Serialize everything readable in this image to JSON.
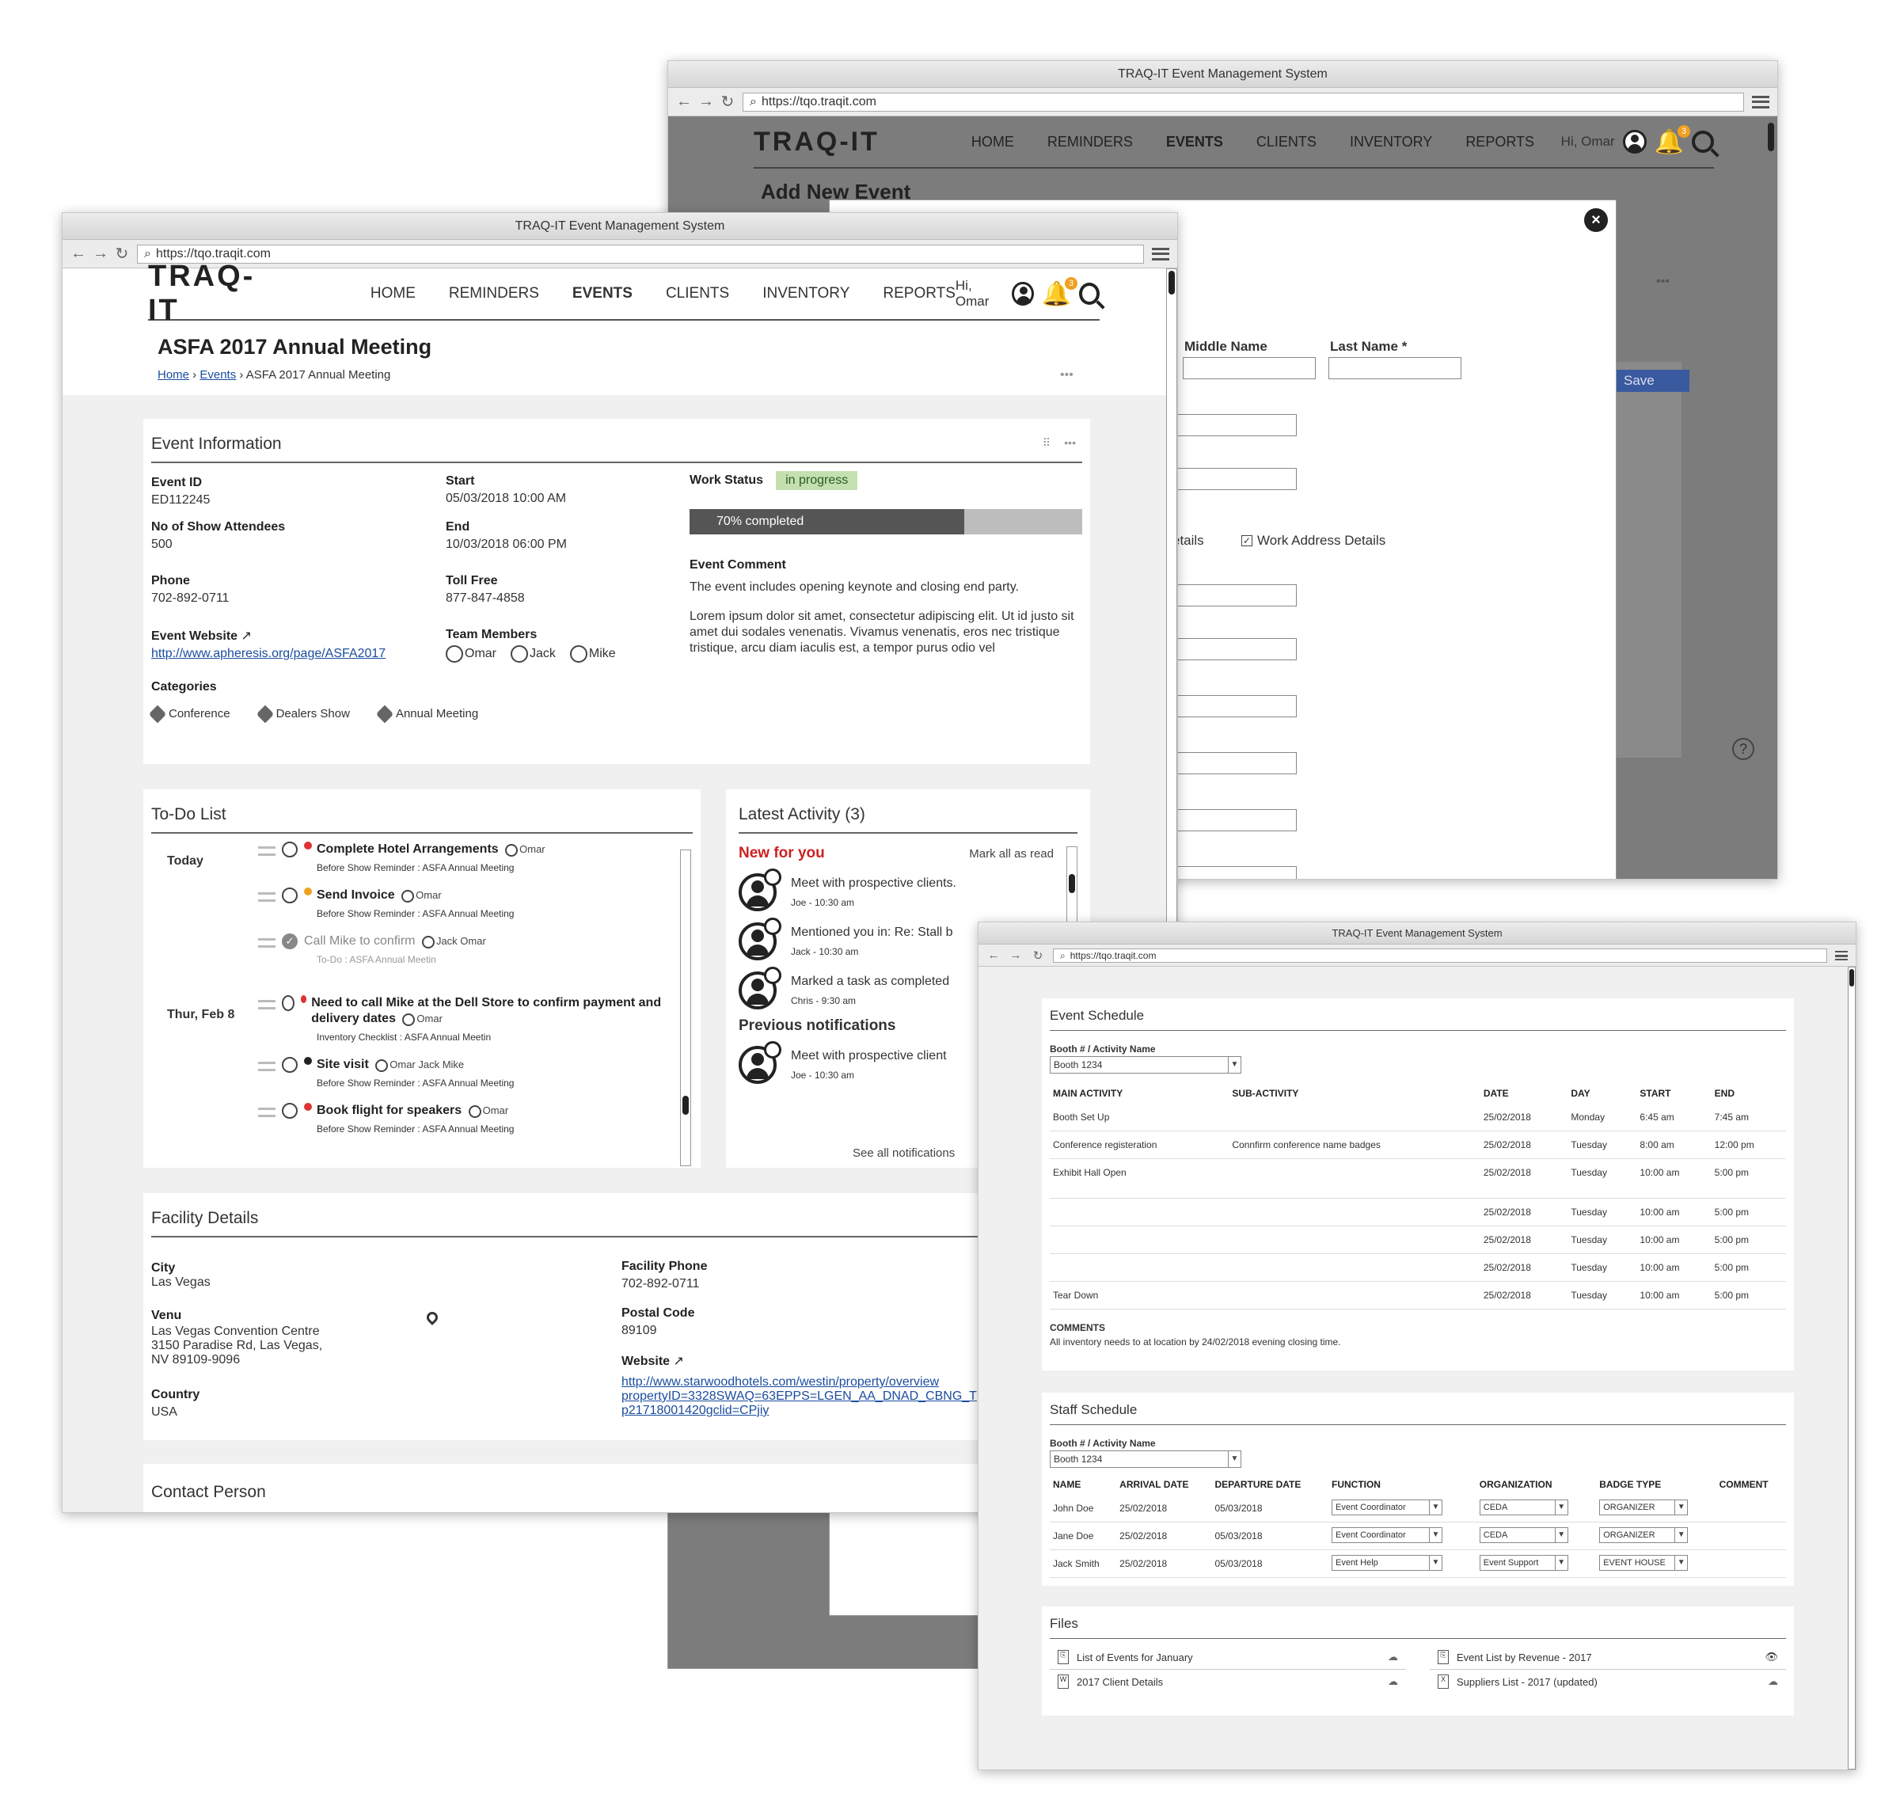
{
  "browser": {
    "title": "TRAQ-IT Event Management System",
    "url": "https://tqo.traqit.com"
  },
  "nav": {
    "logo": "TRAQ-IT",
    "links": [
      "HOME",
      "REMINDERS",
      "EVENTS",
      "CLIENTS",
      "INVENTORY",
      "REPORTS"
    ],
    "active": "EVENTS",
    "greeting": "Hi, Omar",
    "notification_count": "3"
  },
  "back_window": {
    "page_title": "Add New Event",
    "save_label": "Save",
    "middle_name_label": "Middle Name",
    "last_name_label": "Last Name *",
    "home_details_partial": "etails",
    "work_address_label": "Work Address Details"
  },
  "event": {
    "title": "ASFA 2017 Annual Meeting",
    "breadcrumb": {
      "home": "Home",
      "events": "Events",
      "current": "ASFA 2017 Annual Meeting"
    },
    "info_title": "Event Information",
    "event_id_label": "Event ID",
    "event_id": "ED112245",
    "attendees_label": "No of Show Attendees",
    "attendees": "500",
    "phone_label": "Phone",
    "phone": "702-892-0711",
    "website_label": "Event Website",
    "website": "http://www.apheresis.org/page/ASFA2017",
    "start_label": "Start",
    "start": "05/03/2018 10:00 AM",
    "end_label": "End",
    "end": "10/03/2018 06:00 PM",
    "tollfree_label": "Toll Free",
    "tollfree": "877-847-4858",
    "team_label": "Team Members",
    "team": [
      "Omar",
      "Jack",
      "Mike"
    ],
    "work_status_label": "Work Status",
    "work_status": "in progress",
    "progress_text": "70% completed",
    "progress": 0.7,
    "comment_label": "Event Comment",
    "comment1": "The event includes opening keynote and closing end party.",
    "comment2": "Lorem ipsum dolor sit amet, consectetur adipiscing elit. Ut id justo sit amet dui sodales venenatis. Vivamus venenatis, eros nec tristique tristique, arcu diam iaculis est, a tempor purus odio vel",
    "categories_label": "Categories",
    "categories": [
      "Conference",
      "Dealers Show",
      "Annual Meeting"
    ]
  },
  "todo": {
    "title": "To-Do List",
    "groups": [
      {
        "day": "Today",
        "items": [
          {
            "title": "Complete Hotel Arrangements",
            "people": "Omar",
            "sub": "Before Show Reminder : ASFA Annual Meeting",
            "color": "#d33",
            "done": false
          },
          {
            "title": "Send Invoice",
            "people": "Omar",
            "sub": "Before Show Reminder : ASFA Annual Meeting",
            "color": "#f0a020",
            "done": false
          },
          {
            "title": "Call Mike to confirm",
            "people": "Jack   Omar",
            "sub": "To-Do : ASFA Annual Meetin",
            "color": "",
            "done": true
          }
        ]
      },
      {
        "day": "Thur, Feb 8",
        "items": [
          {
            "title": "Need to call Mike at the Dell Store to confirm payment and delivery dates",
            "people": "Omar",
            "sub": "Inventory Checklist  : ASFA Annual Meetin",
            "color": "#d33",
            "done": false
          },
          {
            "title": "Site visit",
            "people": "Omar   Jack   Mike",
            "sub": "Before Show Reminder : ASFA Annual Meeting",
            "color": "#222",
            "done": false
          },
          {
            "title": "Book flight for speakers",
            "people": "Omar",
            "sub": "Before Show Reminder : ASFA Annual Meeting",
            "color": "#d33",
            "done": false
          }
        ]
      }
    ]
  },
  "activity": {
    "title": "Latest Activity (3)",
    "new_label": "New for you",
    "mark_read": "Mark all as read",
    "items": [
      {
        "text": "Meet with prospective clients.",
        "meta": "Joe - 10:30 am"
      },
      {
        "text": "Mentioned you in: Re: Stall b",
        "meta": "Jack - 10:30 am"
      },
      {
        "text": "Marked a task as completed",
        "meta": "Chris - 9:30 am"
      }
    ],
    "prev_label": "Previous notifications",
    "prev_items": [
      {
        "text": "Meet with prospective client",
        "meta": "Joe - 10:30 am"
      }
    ],
    "see_all": "See all notifications"
  },
  "facility": {
    "title": "Facility Details",
    "city_label": "City",
    "city": "Las Vegas",
    "venue_label": "Venu",
    "venue": [
      "Las Vegas Convention Centre",
      "3150 Paradise Rd, Las Vegas,",
      "NV 89109-9096"
    ],
    "country_label": "Country",
    "country": "USA",
    "phone_label": "Facility Phone",
    "phone": "702-892-0711",
    "postal_label": "Postal Code",
    "postal": "89109",
    "website_label": "Website",
    "website": [
      "http://www.starwoodhotels.com/westin/property/overview",
      "propertyID=3328SWAQ=63EPPS=LGEN_AA_DNAD_CBNG_T",
      "p21718001420gclid=CPjiy"
    ],
    "contact_title": "Contact Person"
  },
  "schedule": {
    "title": "Event Schedule",
    "booth_label": "Booth # / Activity Name",
    "booth_value": "Booth 1234",
    "headers": [
      "MAIN ACTIVITY",
      "SUB-ACTIVITY",
      "DATE",
      "DAY",
      "START",
      "END"
    ],
    "rows": [
      [
        "Booth Set Up",
        "",
        "25/02/2018",
        "Monday",
        "6:45 am",
        "7:45 am"
      ],
      [
        "Conference registeration",
        "Connfirm conference name badges",
        "25/02/2018",
        "Tuesday",
        "8:00 am",
        "12:00 pm"
      ],
      [
        "Exhibit Hall Open",
        "",
        "25/02/2018",
        "Tuesday",
        "10:00 am",
        "5:00 pm"
      ],
      [
        "",
        "",
        "25/02/2018",
        "Tuesday",
        "10:00 am",
        "5:00 pm"
      ],
      [
        "",
        "",
        "25/02/2018",
        "Tuesday",
        "10:00 am",
        "5:00 pm"
      ],
      [
        "",
        "",
        "25/02/2018",
        "Tuesday",
        "10:00 am",
        "5:00 pm"
      ],
      [
        "Tear Down",
        "",
        "25/02/2018",
        "Tuesday",
        "10:00 am",
        "5:00 pm"
      ]
    ],
    "comments_label": "COMMENTS",
    "comments": "All inventory needs to at location by 24/02/2018 evening closing time."
  },
  "staff": {
    "title": "Staff Schedule",
    "booth_label": "Booth # / Activity Name",
    "booth_value": "Booth 1234",
    "headers": [
      "NAME",
      "ARRIVAL DATE",
      "DEPARTURE DATE",
      "FUNCTION",
      "ORGANIZATION",
      "BADGE TYPE",
      "COMMENT"
    ],
    "rows": [
      [
        "John Doe",
        "25/02/2018",
        "05/03/2018",
        "Event Coordinator",
        "CEDA",
        "ORGANIZER"
      ],
      [
        "Jane Doe",
        "25/02/2018",
        "05/03/2018",
        "Event Coordinator",
        "CEDA",
        "ORGANIZER"
      ],
      [
        "Jack Smith",
        "25/02/2018",
        "05/03/2018",
        "Event Help",
        "Event Support",
        "EVENT HOUSE"
      ]
    ]
  },
  "files": {
    "title": "Files",
    "items": [
      "List of Events for January",
      "Event List by Revenue - 2017",
      "2017 Client Details",
      "Suppliers List - 2017 (updated)"
    ]
  }
}
